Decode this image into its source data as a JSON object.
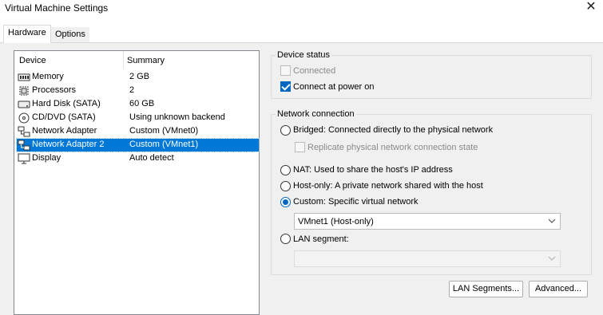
{
  "window": {
    "title": "Virtual Machine Settings",
    "close_symbol": "✕"
  },
  "tabs": [
    {
      "label": "Hardware",
      "active": true
    },
    {
      "label": "Options",
      "active": false
    }
  ],
  "device_list": {
    "headers": {
      "device": "Device",
      "summary": "Summary"
    },
    "rows": [
      {
        "icon": "memory-icon",
        "device": "Memory",
        "summary": "2 GB",
        "selected": false
      },
      {
        "icon": "processor-icon",
        "device": "Processors",
        "summary": "2",
        "selected": false
      },
      {
        "icon": "hard-disk-icon",
        "device": "Hard Disk (SATA)",
        "summary": "60 GB",
        "selected": false
      },
      {
        "icon": "cd-dvd-icon",
        "device": "CD/DVD (SATA)",
        "summary": "Using unknown backend",
        "selected": false
      },
      {
        "icon": "network-adapter-icon",
        "device": "Network Adapter",
        "summary": "Custom (VMnet0)",
        "selected": false
      },
      {
        "icon": "network-adapter-icon",
        "device": "Network Adapter 2",
        "summary": "Custom (VMnet1)",
        "selected": true
      },
      {
        "icon": "display-icon",
        "device": "Display",
        "summary": "Auto detect",
        "selected": false
      }
    ]
  },
  "device_status": {
    "title": "Device status",
    "connected": {
      "label": "Connected",
      "checked": false,
      "enabled": false
    },
    "connect_at_power_on": {
      "label": "Connect at power on",
      "checked": true,
      "enabled": true
    }
  },
  "network_connection": {
    "title": "Network connection",
    "bridged": {
      "label": "Bridged: Connected directly to the physical network",
      "checked": false
    },
    "replicate": {
      "label": "Replicate physical network connection state",
      "checked": false,
      "enabled": false
    },
    "nat": {
      "label": "NAT: Used to share the host's IP address",
      "checked": false
    },
    "host_only": {
      "label": "Host-only: A private network shared with the host",
      "checked": false
    },
    "custom": {
      "label": "Custom: Specific virtual network",
      "checked": true
    },
    "custom_select": {
      "value": "VMnet1 (Host-only)"
    },
    "lan_segment": {
      "label": "LAN segment:",
      "checked": false
    },
    "lan_segment_select": {
      "value": "",
      "enabled": false
    }
  },
  "buttons": {
    "lan_segments": "LAN Segments...",
    "advanced": "Advanced..."
  },
  "colors": {
    "selection": "#0078d7",
    "accent": "#0067c0",
    "panel": "#f0f0f0"
  }
}
